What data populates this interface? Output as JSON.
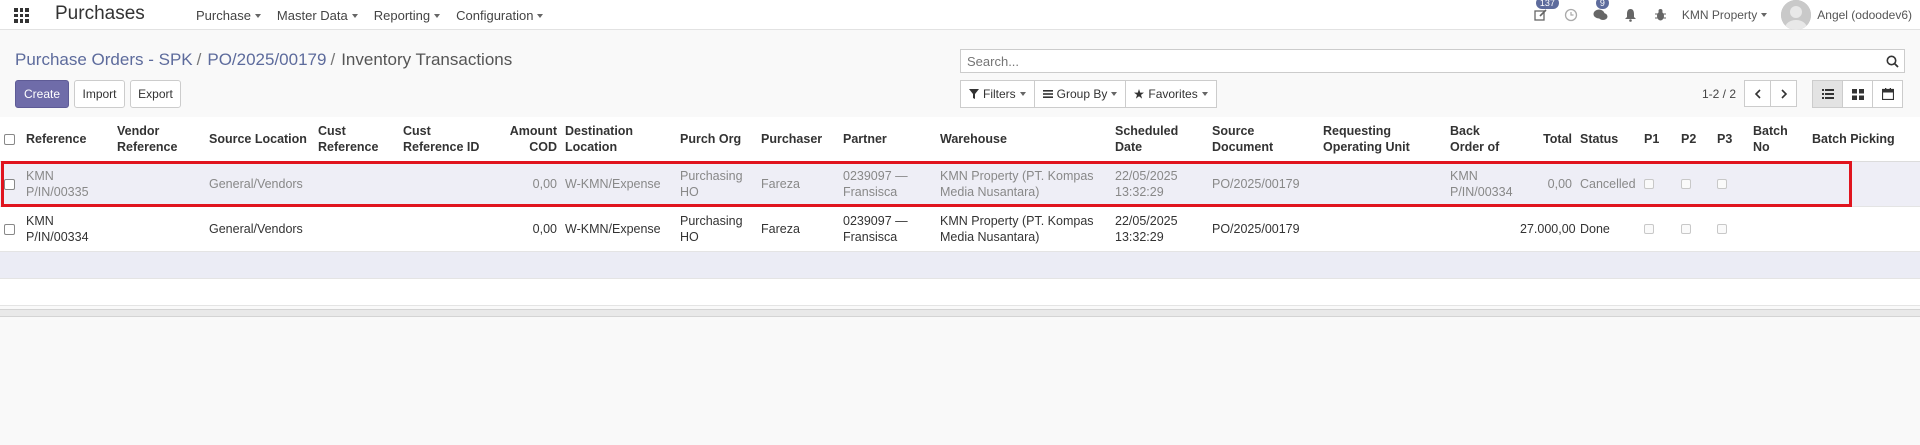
{
  "navbar": {
    "app_name": "Purchases",
    "menus": [
      "Purchase",
      "Master Data",
      "Reporting",
      "Configuration"
    ],
    "activity_badge": "137",
    "messages_badge": "9",
    "company": "KMN Property",
    "user": "Angel (odoodev6)"
  },
  "breadcrumb": {
    "items": [
      "Purchase Orders - SPK",
      "PO/2025/00179"
    ],
    "separator": "/",
    "current": "Inventory Transactions"
  },
  "buttons": {
    "create": "Create",
    "import": "Import",
    "export": "Export"
  },
  "search": {
    "placeholder": "Search..."
  },
  "filters": {
    "filters": "Filters",
    "group_by": "Group By",
    "favorites": "Favorites"
  },
  "pager": {
    "value": "1-2 / 2"
  },
  "table": {
    "columns": {
      "reference": "Reference",
      "vendor_reference": "Vendor Reference",
      "source_location": "Source Location",
      "cust_reference": "Cust Reference",
      "cust_reference_id": "Cust Reference ID",
      "amount_cod": "Amount COD",
      "destination_location": "Destination Location",
      "purch_org": "Purch Org",
      "purchaser": "Purchaser",
      "partner": "Partner",
      "warehouse": "Warehouse",
      "scheduled_date": "Scheduled Date",
      "source_document": "Source Document",
      "requesting_operating_unit": "Requesting Operating Unit",
      "back_order_of": "Back Order of",
      "total": "Total",
      "status": "Status",
      "p1": "P1",
      "p2": "P2",
      "p3": "P3",
      "batch_no": "Batch No",
      "batch_picking": "Batch Picking"
    },
    "rows": [
      {
        "reference": "KMN P/IN/00335",
        "vendor_reference": "",
        "source_location": "General/Vendors",
        "cust_reference": "",
        "cust_reference_id": "",
        "amount_cod": "0,00",
        "destination_location": "W-KMN/Expense",
        "purch_org": "Purchasing HO",
        "purchaser": "Fareza",
        "partner": "0239097 — Fransisca",
        "warehouse": "KMN Property (PT. Kompas Media Nusantara)",
        "scheduled_date": "22/05/2025 13:32:29",
        "source_document": "PO/2025/00179",
        "requesting_operating_unit": "",
        "back_order_of": "KMN P/IN/00334",
        "total": "0,00",
        "status": "Cancelled",
        "batch_no": "",
        "batch_picking": ""
      },
      {
        "reference": "KMN P/IN/00334",
        "vendor_reference": "",
        "source_location": "General/Vendors",
        "cust_reference": "",
        "cust_reference_id": "",
        "amount_cod": "0,00",
        "destination_location": "W-KMN/Expense",
        "purch_org": "Purchasing HO",
        "purchaser": "Fareza",
        "partner": "0239097 — Fransisca",
        "warehouse": "KMN Property (PT. Kompas Media Nusantara)",
        "scheduled_date": "22/05/2025 13:32:29",
        "source_document": "PO/2025/00179",
        "requesting_operating_unit": "",
        "back_order_of": "",
        "total": "27.000,00",
        "status": "Done",
        "batch_no": "",
        "batch_picking": ""
      }
    ]
  },
  "colors": {
    "brand": "#6f6ca9",
    "link": "#5d6b9c",
    "highlight": "#e0141e"
  }
}
